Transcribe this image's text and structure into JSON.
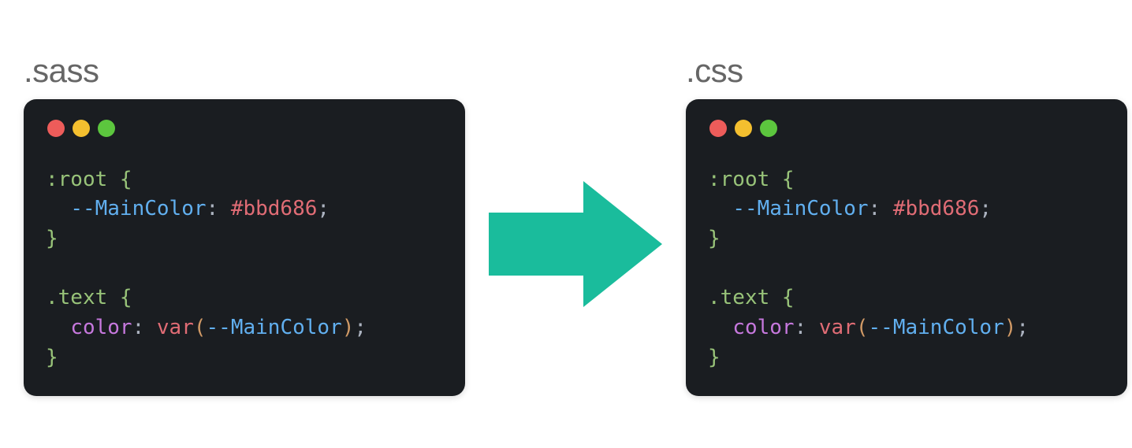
{
  "left": {
    "title": ".sass",
    "tokens": [
      [
        {
          "text": ":root ",
          "cls": "tok-selector"
        },
        {
          "text": "{",
          "cls": "tok-brace"
        }
      ],
      [
        {
          "text": "  ",
          "cls": "tok-punct"
        },
        {
          "text": "--MainColor",
          "cls": "tok-prop"
        },
        {
          "text": ": ",
          "cls": "tok-punct"
        },
        {
          "text": "#bbd686",
          "cls": "tok-hex"
        },
        {
          "text": ";",
          "cls": "tok-punct"
        }
      ],
      [
        {
          "text": "}",
          "cls": "tok-brace"
        }
      ],
      [
        {
          "text": " ",
          "cls": "tok-punct"
        }
      ],
      [
        {
          "text": ".text ",
          "cls": "tok-selector"
        },
        {
          "text": "{",
          "cls": "tok-brace"
        }
      ],
      [
        {
          "text": "  ",
          "cls": "tok-punct"
        },
        {
          "text": "color",
          "cls": "tok-color"
        },
        {
          "text": ": ",
          "cls": "tok-punct"
        },
        {
          "text": "var",
          "cls": "tok-func"
        },
        {
          "text": "(",
          "cls": "tok-paren"
        },
        {
          "text": "--MainColor",
          "cls": "tok-prop"
        },
        {
          "text": ")",
          "cls": "tok-paren"
        },
        {
          "text": ";",
          "cls": "tok-punct"
        }
      ],
      [
        {
          "text": "}",
          "cls": "tok-brace"
        }
      ]
    ]
  },
  "right": {
    "title": ".css",
    "tokens": [
      [
        {
          "text": ":root ",
          "cls": "tok-selector"
        },
        {
          "text": "{",
          "cls": "tok-brace"
        }
      ],
      [
        {
          "text": "  ",
          "cls": "tok-punct"
        },
        {
          "text": "--MainColor",
          "cls": "tok-prop"
        },
        {
          "text": ": ",
          "cls": "tok-punct"
        },
        {
          "text": "#bbd686",
          "cls": "tok-hex"
        },
        {
          "text": ";",
          "cls": "tok-punct"
        }
      ],
      [
        {
          "text": "}",
          "cls": "tok-brace"
        }
      ],
      [
        {
          "text": " ",
          "cls": "tok-punct"
        }
      ],
      [
        {
          "text": ".text ",
          "cls": "tok-selector"
        },
        {
          "text": "{",
          "cls": "tok-brace"
        }
      ],
      [
        {
          "text": "  ",
          "cls": "tok-punct"
        },
        {
          "text": "color",
          "cls": "tok-color"
        },
        {
          "text": ": ",
          "cls": "tok-punct"
        },
        {
          "text": "var",
          "cls": "tok-func"
        },
        {
          "text": "(",
          "cls": "tok-paren"
        },
        {
          "text": "--MainColor",
          "cls": "tok-prop"
        },
        {
          "text": ")",
          "cls": "tok-paren"
        },
        {
          "text": ";",
          "cls": "tok-punct"
        }
      ],
      [
        {
          "text": "}",
          "cls": "tok-brace"
        }
      ]
    ]
  },
  "arrow_color": "#1abc9c"
}
